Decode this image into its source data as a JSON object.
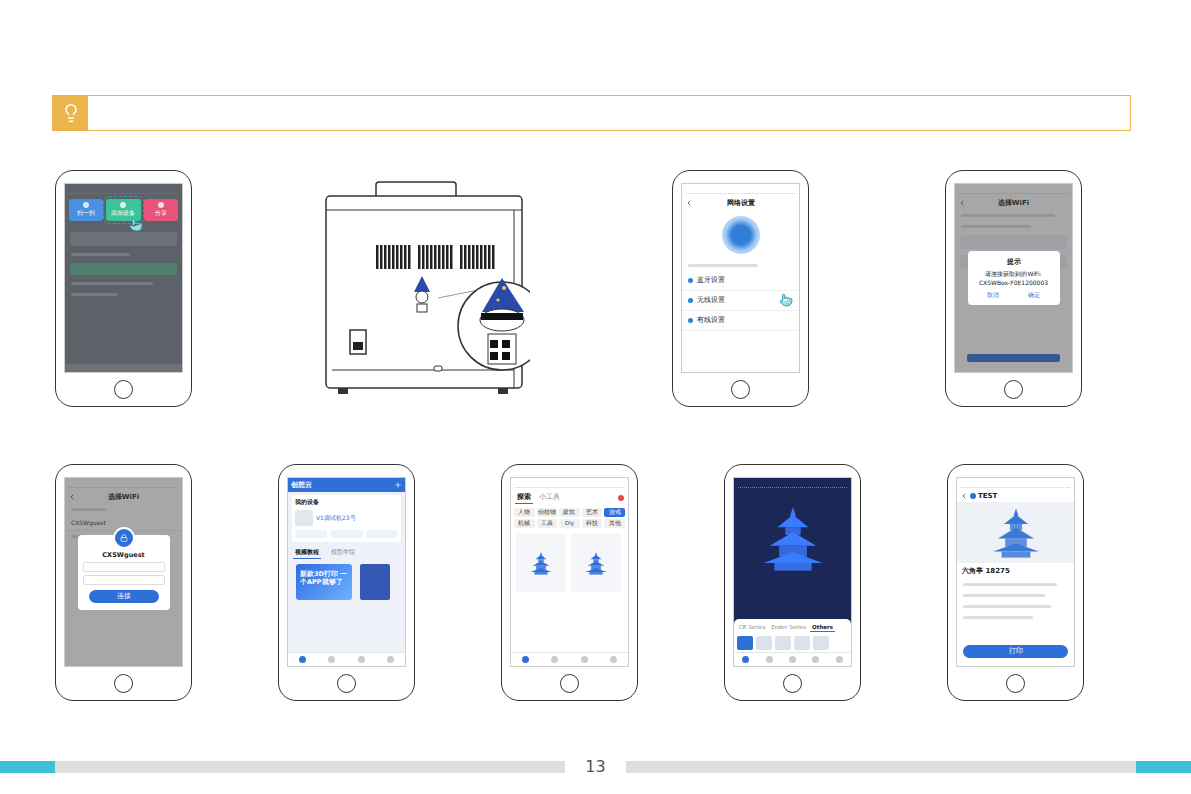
{
  "top_row": [
    {
      "kind": "home",
      "dimmed": true,
      "buttons": [
        {
          "label": "扫一扫",
          "selected": false,
          "color": "#4a90e2"
        },
        {
          "label": "添加设备",
          "selected": true,
          "color": "#3cc39a"
        },
        {
          "label": "分享",
          "selected": false,
          "color": "#e8537a"
        }
      ]
    },
    {
      "kind": "printer"
    },
    {
      "kind": "network",
      "title": "网络设置",
      "options": [
        {
          "label": "蓝牙设置",
          "selected": false
        },
        {
          "label": "无线设置",
          "selected": true
        },
        {
          "label": "有线设置",
          "selected": false
        }
      ]
    },
    {
      "kind": "wifi-prompt",
      "title": "选择WiFi",
      "dialog": {
        "title": "提示",
        "message": "请连接获取到的WiFi: CXSWBox-F0E1200003",
        "buttons": [
          "取消",
          "确定"
        ]
      }
    }
  ],
  "bottom_row": [
    {
      "kind": "wifi-connect",
      "title": "选择WiFi",
      "networks": [
        "CXSWguest"
      ],
      "dialog": {
        "title": "CXSWguest",
        "button": "连接"
      }
    },
    {
      "kind": "app-home",
      "title": "创想云",
      "section": "我的设备",
      "device": "V1调试机23号",
      "tabs": [
        {
          "label": "视频教程",
          "selected": true
        },
        {
          "label": "模型学院",
          "selected": false
        }
      ],
      "banner": "新款3D打印 一个APP就够了"
    },
    {
      "kind": "explore",
      "tabs": [
        {
          "label": "探索",
          "selected": true
        },
        {
          "label": "小工具",
          "selected": false
        }
      ],
      "chips": [
        {
          "label": "人物",
          "selected": false
        },
        {
          "label": "动植物",
          "selected": false
        },
        {
          "label": "建筑",
          "selected": false
        },
        {
          "label": "艺术",
          "selected": false
        },
        {
          "label": "游戏",
          "selected": true
        },
        {
          "label": "机械",
          "selected": false
        },
        {
          "label": "工具",
          "selected": false
        },
        {
          "label": "Diy",
          "selected": false
        },
        {
          "label": "科技",
          "selected": false
        },
        {
          "label": "其他",
          "selected": false
        }
      ]
    },
    {
      "kind": "slicer",
      "tabs": [
        {
          "label": "CR Series",
          "selected": false
        },
        {
          "label": "Ender Series",
          "selected": false
        },
        {
          "label": "Others",
          "selected": true
        }
      ]
    },
    {
      "kind": "model-detail",
      "title": "TEST",
      "model": "六角亭 18275",
      "button": "打印"
    }
  ],
  "footer": {
    "page": "13"
  }
}
